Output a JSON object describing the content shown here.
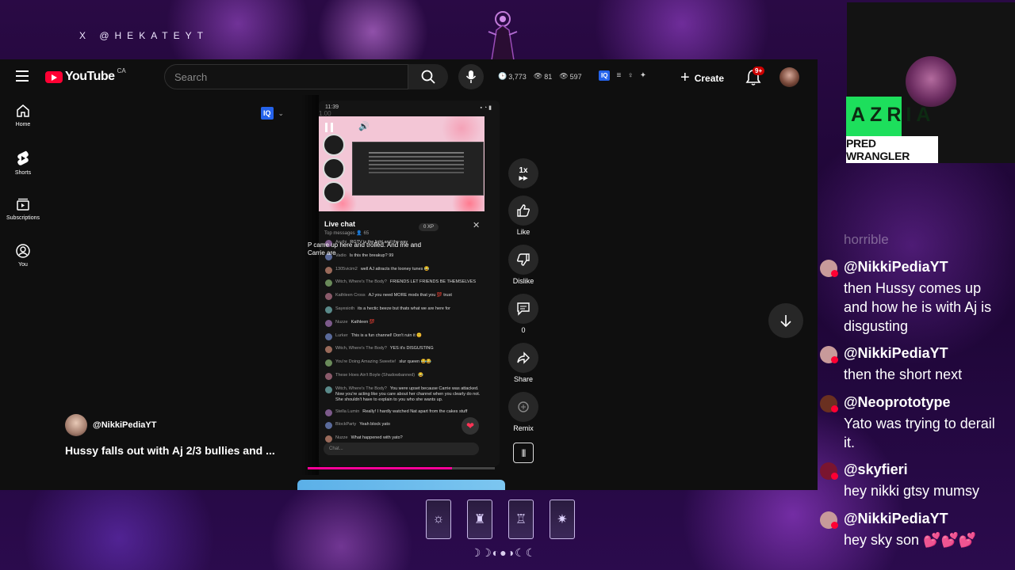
{
  "overlay": {
    "handle": "X @HEKATEYT"
  },
  "topbar": {
    "logo_text": "YouTube",
    "country_code": "CA",
    "search_placeholder": "Search",
    "stats": [
      "3,773",
      "81",
      "597"
    ],
    "iq_label": "IQ",
    "create_label": "Create",
    "notifications_badge": "9+"
  },
  "nav": {
    "items": [
      {
        "label": "Home",
        "icon": "home-icon"
      },
      {
        "label": "Shorts",
        "icon": "shorts-icon"
      },
      {
        "label": "Subscriptions",
        "icon": "subscriptions-icon"
      },
      {
        "label": "You",
        "icon": "you-icon"
      }
    ]
  },
  "short": {
    "phone_time": "11:39",
    "speed_ghost": "1.00",
    "live_chat_title": "Live chat",
    "live_chat_sub": "Top messages  👤 65",
    "xp_label": "0 XP",
    "overlay_text": "P came up here and trolled. And me and Carrie are",
    "chat_input_placeholder": "Chat...",
    "messages": [
      {
        "name": "Aruthi",
        "text": "RGTV is the light and the way"
      },
      {
        "name": "Vadio",
        "text": "Is this the breakup? 99"
      },
      {
        "name": "1305vicim2",
        "text": "well AJ attracts the looney tunes 😂"
      },
      {
        "name": "Witch, Where's The Body?",
        "text": "FRIENDS LET FRIENDS BE THEMSELVES"
      },
      {
        "name": "Kathleen Cross",
        "text": "AJ you need MORE mods that you 💯 trust"
      },
      {
        "name": "Sayesioth",
        "text": "its a hectic beeze but thats what we are here for"
      },
      {
        "name": "Nuzze",
        "text": "Kathleen 💯"
      },
      {
        "name": "Lurker",
        "text": "This is a fun channel! Don't ruin it 😊"
      },
      {
        "name": "Witch, Where's The Body?",
        "text": "YES it's DISGUSTING"
      },
      {
        "name": "You're Doing Amazing Sweetie!",
        "text": "slur queen 😂😂"
      },
      {
        "name": "These Hoes Ain't Boyle (Shadowbanned)",
        "text": "😂"
      },
      {
        "name": "Witch, Where's The Body?",
        "text": "You were upset because Carrie was attacked. Now you're acting like you care about her channel when you clearly do not. She shouldn't have to explain to you who she wants up."
      },
      {
        "name": "Stella Lumin",
        "text": "Really! I hardly watched Nat apart from the cakes stuff"
      },
      {
        "name": "BlockParty",
        "text": "Yeah block yato"
      },
      {
        "name": "Nuzze",
        "text": "What happened with yato?"
      }
    ],
    "actions": {
      "speed": "1x",
      "like": "Like",
      "dislike": "Dislike",
      "comments": "0",
      "share": "Share",
      "remix": "Remix"
    },
    "progress": 0.77,
    "channel": "@NikkiPediaYT",
    "title": "Hussy falls out with Aj 2/3 bullies and ..."
  },
  "webcam": {
    "name": "AZRIA",
    "role": "PRED WRANGLER"
  },
  "stream_chat": {
    "faded": "horrible",
    "messages": [
      {
        "user": "@NikkiPediaYT",
        "text": "then Hussy comes up and how he is with Aj is disgusting",
        "color": "#c89a9a"
      },
      {
        "user": "@NikkiPediaYT",
        "text": "then the short next",
        "color": "#c89a9a"
      },
      {
        "user": "@Neoprototype",
        "text": "Yato was trying to derail it.",
        "color": "#6a3020"
      },
      {
        "user": "@skyfieri",
        "text": "hey nikki gtsy mumsy",
        "color": "#7a1530"
      },
      {
        "user": "@NikkiPediaYT",
        "text": "hey sky son 💕💕💕",
        "color": "#c89a9a"
      }
    ]
  },
  "colors": {
    "accent_pink": "#ff0099",
    "yt_red": "#ff0033",
    "azria_green": "#1ddf5c"
  }
}
